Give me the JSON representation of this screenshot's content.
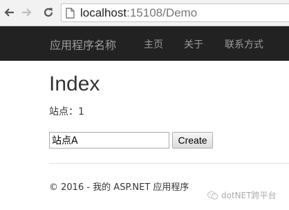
{
  "browser": {
    "url_host": "localhost",
    "url_rest": ":15108/Demo"
  },
  "navbar": {
    "brand": "应用程序名称",
    "links": [
      "主页",
      "关于",
      "联系方式"
    ]
  },
  "main": {
    "title": "Index",
    "site_count": "站点：1",
    "input_value": "站点A",
    "create_label": "Create"
  },
  "footer": {
    "text": "© 2016 - 我的 ASP.NET 应用程序"
  },
  "watermark": {
    "text": "dotNET跨平台"
  }
}
